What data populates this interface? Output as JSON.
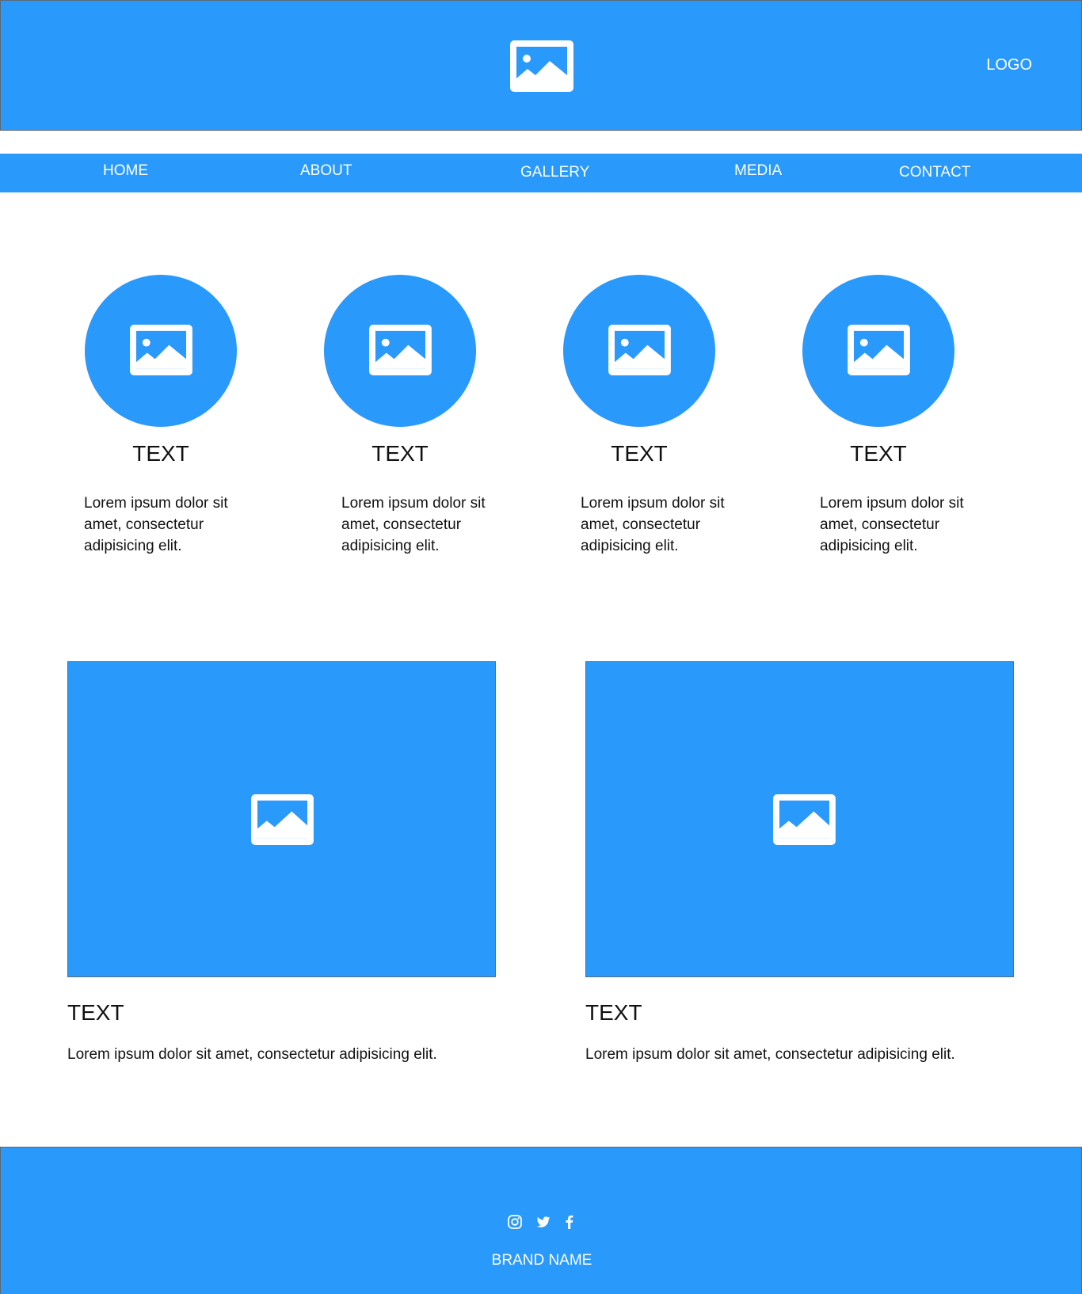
{
  "header": {
    "logo_text": "LOGO",
    "hero_icon": "image-icon"
  },
  "nav": {
    "items": [
      "HOME",
      "ABOUT",
      "GALLERY",
      "MEDIA",
      "CONTACT"
    ]
  },
  "cards": [
    {
      "icon": "image-icon",
      "title": "TEXT",
      "body": "Lorem ipsum dolor sit amet, consectetur adipisicing elit."
    },
    {
      "icon": "image-icon",
      "title": "TEXT",
      "body": "Lorem ipsum dolor sit amet, consectetur adipisicing elit."
    },
    {
      "icon": "image-icon",
      "title": "TEXT",
      "body": "Lorem ipsum dolor sit amet, consectetur adipisicing elit."
    },
    {
      "icon": "image-icon",
      "title": "TEXT",
      "body": "Lorem ipsum dolor sit amet, consectetur adipisicing elit."
    }
  ],
  "features": [
    {
      "icon": "image-icon",
      "title": "TEXT",
      "body": "Lorem ipsum dolor sit amet, consectetur adipisicing elit."
    },
    {
      "icon": "image-icon",
      "title": "TEXT",
      "body": "Lorem ipsum dolor sit amet, consectetur adipisicing elit."
    }
  ],
  "footer": {
    "social_icons": [
      "instagram-icon",
      "twitter-icon",
      "facebook-icon"
    ],
    "brand_name": "BRAND NAME"
  },
  "colors": {
    "accent": "#2999fc",
    "text": "#111111",
    "background": "#ffffff"
  }
}
